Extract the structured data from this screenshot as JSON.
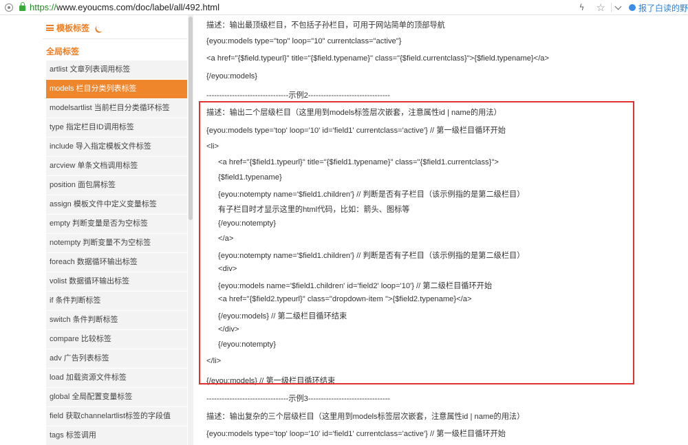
{
  "browser": {
    "url_protocol": "https://",
    "url_rest": "www.eyoucms.com/doc/label/all/492.html",
    "news_text": "报了白读的野"
  },
  "sidebar": {
    "header": "模板标签",
    "category": "全局标签",
    "items": [
      {
        "label": "artlist 文章列表调用标签"
      },
      {
        "label": "models 栏目分类列表标签"
      },
      {
        "label": "modelsartlist 当前栏目分类循环标签"
      },
      {
        "label": "type 指定栏目ID调用标签"
      },
      {
        "label": "include 导入指定模板文件标签"
      },
      {
        "label": "arcview 单条文档调用标签"
      },
      {
        "label": "position 面包屑标签"
      },
      {
        "label": "assign 模板文件中定义变量标签"
      },
      {
        "label": "empty 判断变量是否为空标签"
      },
      {
        "label": "notempty 判断变量不为空标签"
      },
      {
        "label": "foreach 数据循环输出标签"
      },
      {
        "label": "volist 数据循环输出标签"
      },
      {
        "label": "if 条件判断标签"
      },
      {
        "label": "switch 条件判断标签"
      },
      {
        "label": "compare 比较标签"
      },
      {
        "label": "adv 广告列表标签"
      },
      {
        "label": "load 加载资源文件标签"
      },
      {
        "label": "global 全局配置变量标签"
      },
      {
        "label": "field 获取channelartlist标签的字段值"
      },
      {
        "label": "tags 标签调用"
      }
    ]
  },
  "content": {
    "lines": [
      {
        "text": "描述：输出最顶级栏目，不包括子孙栏目，可用于网站简单的顶部导航"
      },
      {
        "text": "{eyou:models type=\"top\" loop=\"10\" currentclass=\"active\"}"
      },
      {
        "text": "<a href=\"{$field.typeurl}\" title=\"{$field.typename}\" class=\"{$field.currentclass}\">{$field.typename}</a>"
      },
      {
        "text": "{/eyou:models}"
      },
      {
        "text": "--------------------------------示例2--------------------------------"
      },
      {
        "text": "描述：输出二个层级栏目（这里用到models标签层次嵌套，注意属性id | name的用法）"
      },
      {
        "text": "{eyou:models type='top' loop='10' id='field1' currentclass='active'} // 第一级栏目循环开始"
      },
      {
        "text": "<li>"
      },
      {
        "text": "<a href=\"{$field1.typeurl}\" title=\"{$field1.typename}\" class=\"{$field1.currentclass}\">"
      },
      {
        "text": "{$field1.typename}"
      },
      {
        "text": "{eyou:notempty name='$field1.children'} // 判断是否有子栏目（该示例指的是第二级栏目）"
      },
      {
        "text": "有子栏目时才显示这里的html代码，比如：箭头、图标等"
      },
      {
        "text": "{/eyou:notempty}"
      },
      {
        "text": "</a>"
      },
      {
        "text": "{eyou:notempty name='$field1.children'} // 判断是否有子栏目（该示例指的是第二级栏目）"
      },
      {
        "text": "<div>"
      },
      {
        "text": "{eyou:models name='$field1.children' id='field2' loop='10'} // 第二级栏目循环开始"
      },
      {
        "text": "<a href=\"{$field2.typeurl}\" class=\"dropdown-item \">{$field2.typename}</a>"
      },
      {
        "text": "{/eyou:models} // 第二级栏目循环结束"
      },
      {
        "text": "</div>"
      },
      {
        "text": "{/eyou:notempty}"
      },
      {
        "text": "</li>"
      },
      {
        "text": "{/eyou:models} // 第一级栏目循环结束"
      },
      {
        "text": "--------------------------------示例3--------------------------------"
      },
      {
        "text": "描述：输出复杂的三个层级栏目（这里用到models标签层次嵌套，注意属性id | name的用法）"
      },
      {
        "text": "{eyou:models type='top' loop='10' id='field1' currentclass='active'} // 第一级栏目循环开始"
      }
    ]
  }
}
